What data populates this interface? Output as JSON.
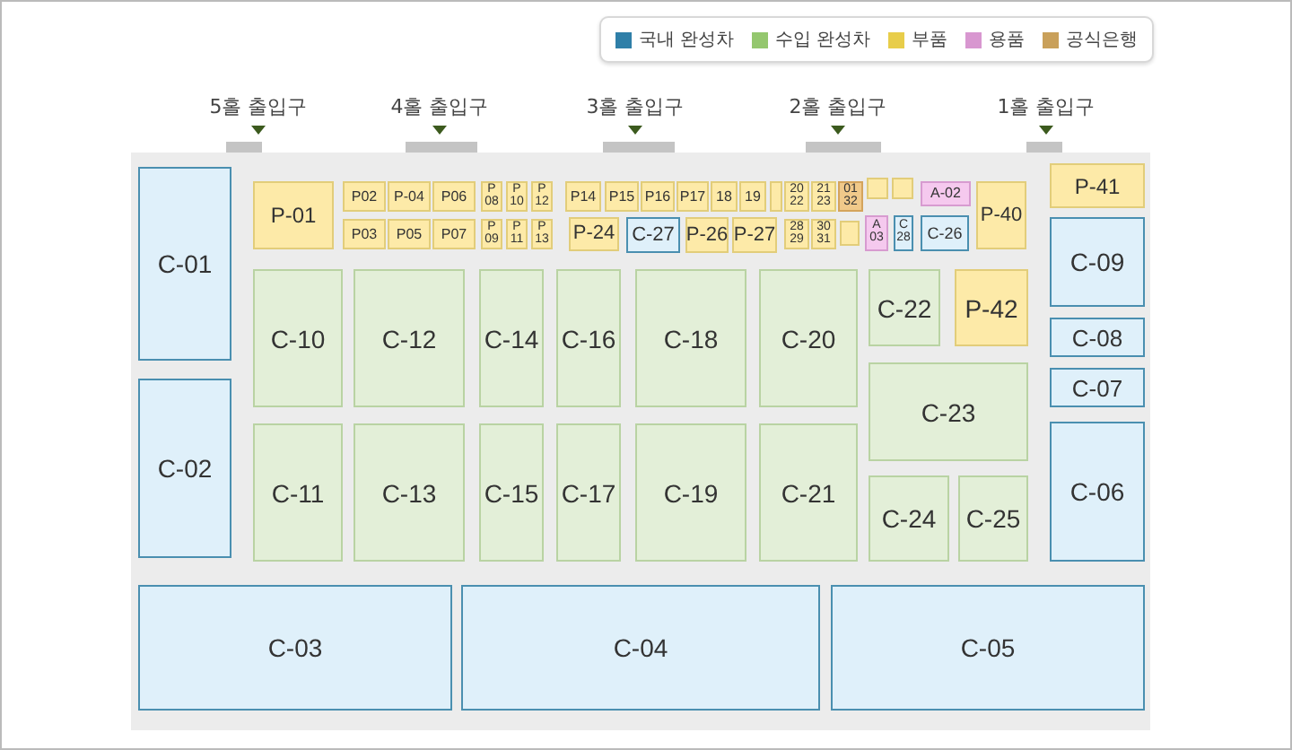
{
  "legend": [
    {
      "label": "국내 완성차",
      "color": "#2f7fa8"
    },
    {
      "label": "수입 완성차",
      "color": "#94c76e"
    },
    {
      "label": "부품",
      "color": "#e8cd4a"
    },
    {
      "label": "용품",
      "color": "#d897d0"
    },
    {
      "label": "공식은행",
      "color": "#c9a05a"
    }
  ],
  "entrances": [
    {
      "label": "5홀 출입구"
    },
    {
      "label": "4홀 출입구"
    },
    {
      "label": "3홀 출입구"
    },
    {
      "label": "2홀 출입구"
    },
    {
      "label": "1홀 출입구"
    }
  ],
  "booths": [
    {
      "label": "C-01",
      "kind": "domestic"
    },
    {
      "label": "C-02",
      "kind": "domestic"
    },
    {
      "label": "C-03",
      "kind": "domestic"
    },
    {
      "label": "C-04",
      "kind": "domestic"
    },
    {
      "label": "C-05",
      "kind": "domestic"
    },
    {
      "label": "P-41",
      "kind": "parts"
    },
    {
      "label": "C-09",
      "kind": "domestic"
    },
    {
      "label": "C-08",
      "kind": "domestic"
    },
    {
      "label": "C-07",
      "kind": "domestic"
    },
    {
      "label": "C-06",
      "kind": "domestic"
    },
    {
      "label": "C-10",
      "kind": "imported"
    },
    {
      "label": "C-12",
      "kind": "imported"
    },
    {
      "label": "C-14",
      "kind": "imported"
    },
    {
      "label": "C-16",
      "kind": "imported"
    },
    {
      "label": "C-18",
      "kind": "imported"
    },
    {
      "label": "C-20",
      "kind": "imported"
    },
    {
      "label": "C-11",
      "kind": "imported"
    },
    {
      "label": "C-13",
      "kind": "imported"
    },
    {
      "label": "C-15",
      "kind": "imported"
    },
    {
      "label": "C-17",
      "kind": "imported"
    },
    {
      "label": "C-19",
      "kind": "imported"
    },
    {
      "label": "C-21",
      "kind": "imported"
    },
    {
      "label": "C-22",
      "kind": "imported"
    },
    {
      "label": "P-42",
      "kind": "parts"
    },
    {
      "label": "C-23",
      "kind": "imported"
    },
    {
      "label": "C-24",
      "kind": "imported"
    },
    {
      "label": "C-25",
      "kind": "imported"
    },
    {
      "label": "P-01",
      "kind": "parts"
    },
    {
      "label": "P02",
      "kind": "parts"
    },
    {
      "label": "P-04",
      "kind": "parts"
    },
    {
      "label": "P06",
      "kind": "parts"
    },
    {
      "label": "P03",
      "kind": "parts"
    },
    {
      "label": "P05",
      "kind": "parts"
    },
    {
      "label": "P07",
      "kind": "parts"
    },
    {
      "lines": [
        "P",
        "08"
      ],
      "kind": "parts"
    },
    {
      "lines": [
        "P",
        "10"
      ],
      "kind": "parts"
    },
    {
      "lines": [
        "P",
        "12"
      ],
      "kind": "parts"
    },
    {
      "lines": [
        "P",
        "09"
      ],
      "kind": "parts"
    },
    {
      "lines": [
        "P",
        "11"
      ],
      "kind": "parts"
    },
    {
      "lines": [
        "P",
        "13"
      ],
      "kind": "parts"
    },
    {
      "label": "P14",
      "kind": "parts"
    },
    {
      "label": "P15",
      "kind": "parts"
    },
    {
      "label": "P16",
      "kind": "parts"
    },
    {
      "label": "P17",
      "kind": "parts"
    },
    {
      "label": "18",
      "kind": "parts"
    },
    {
      "label": "19",
      "kind": "parts"
    },
    {
      "kind": "parts"
    },
    {
      "lines": [
        "20",
        "22"
      ],
      "kind": "parts"
    },
    {
      "lines": [
        "21",
        "23"
      ],
      "kind": "parts"
    },
    {
      "lines": [
        "01",
        "32"
      ],
      "kind": "bank"
    },
    {
      "kind": "parts"
    },
    {
      "kind": "parts"
    },
    {
      "label": "A-02",
      "kind": "goods"
    },
    {
      "label": "P-24",
      "kind": "parts"
    },
    {
      "label": "C-27",
      "kind": "domestic"
    },
    {
      "label": "P-26",
      "kind": "parts"
    },
    {
      "label": "P-27",
      "kind": "parts"
    },
    {
      "lines": [
        "28",
        "29"
      ],
      "kind": "parts"
    },
    {
      "lines": [
        "30",
        "31"
      ],
      "kind": "parts"
    },
    {
      "kind": "parts"
    },
    {
      "lines": [
        "A",
        "03"
      ],
      "kind": "goods"
    },
    {
      "lines": [
        "C",
        "28"
      ],
      "kind": "domestic"
    },
    {
      "label": "C-26",
      "kind": "domestic"
    },
    {
      "label": "P-40",
      "kind": "parts"
    }
  ]
}
